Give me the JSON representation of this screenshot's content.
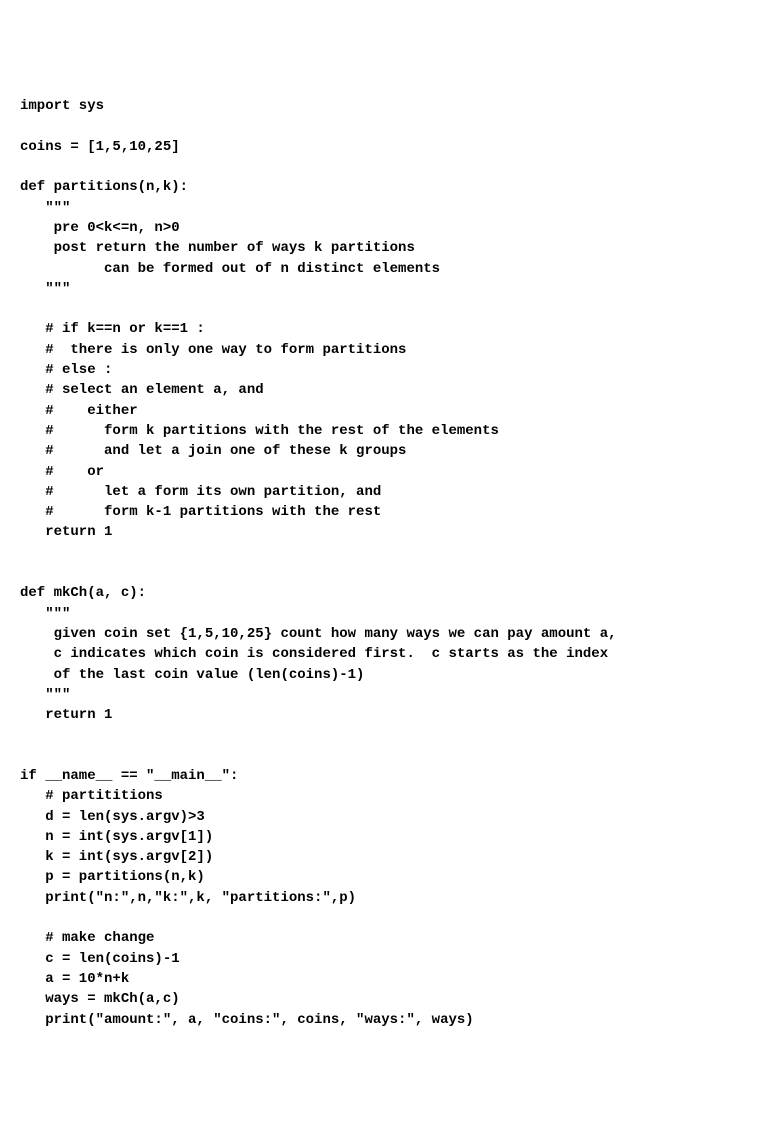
{
  "code": {
    "lines": [
      "import sys",
      "",
      "coins = [1,5,10,25]",
      "",
      "def partitions(n,k):",
      "   \"\"\"",
      "    pre 0<k<=n, n>0",
      "    post return the number of ways k partitions",
      "          can be formed out of n distinct elements",
      "   \"\"\"",
      "",
      "   # if k==n or k==1 :",
      "   #  there is only one way to form partitions",
      "   # else :",
      "   # select an element a, and",
      "   #    either",
      "   #      form k partitions with the rest of the elements",
      "   #      and let a join one of these k groups",
      "   #    or",
      "   #      let a form its own partition, and",
      "   #      form k-1 partitions with the rest",
      "   return 1",
      "",
      "",
      "def mkCh(a, c):",
      "   \"\"\"",
      "    given coin set {1,5,10,25} count how many ways we can pay amount a,",
      "    c indicates which coin is considered first.  c starts as the index",
      "    of the last coin value (len(coins)-1)",
      "   \"\"\"",
      "   return 1",
      "",
      "",
      "if __name__ == \"__main__\":",
      "   # partititions",
      "   d = len(sys.argv)>3",
      "   n = int(sys.argv[1])",
      "   k = int(sys.argv[2])",
      "   p = partitions(n,k)",
      "   print(\"n:\",n,\"k:\",k, \"partitions:\",p)",
      "",
      "   # make change",
      "   c = len(coins)-1",
      "   a = 10*n+k",
      "   ways = mkCh(a,c)",
      "   print(\"amount:\", a, \"coins:\", coins, \"ways:\", ways)"
    ]
  }
}
